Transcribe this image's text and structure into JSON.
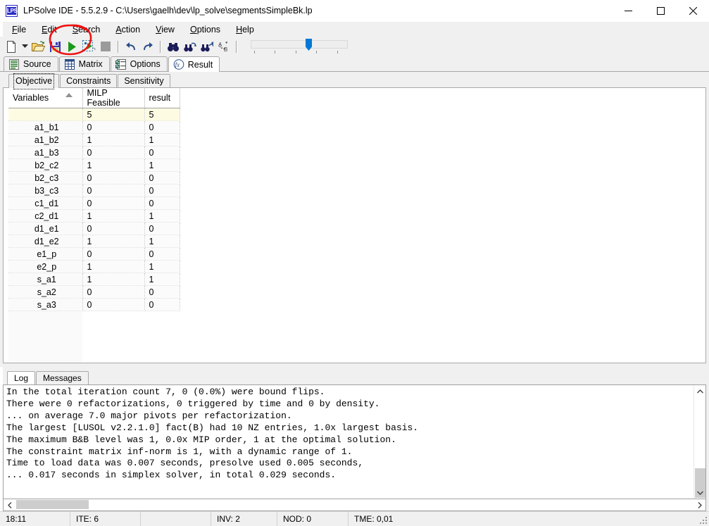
{
  "window": {
    "title": "LPSolve IDE - 5.5.2.9 - C:\\Users\\gaelh\\dev\\lp_solve\\segmentsSimpleBk.lp",
    "icon": "LPS",
    "minimize_label": "Minimize",
    "maximize_label": "Maximize",
    "close_label": "Close"
  },
  "menu": {
    "items": [
      {
        "accel": "F",
        "rest": "ile",
        "name": "file"
      },
      {
        "accel": "E",
        "rest": "dit",
        "name": "edit"
      },
      {
        "accel": "S",
        "rest": "earch",
        "name": "search"
      },
      {
        "accel": "A",
        "rest": "ction",
        "name": "action"
      },
      {
        "accel": "V",
        "rest": "iew",
        "name": "view"
      },
      {
        "accel": "O",
        "rest": "ptions",
        "name": "options"
      },
      {
        "accel": "H",
        "rest": "elp",
        "name": "help"
      }
    ]
  },
  "toolbar": {
    "buttons": [
      {
        "icon": "new-file-icon",
        "label": "New"
      },
      {
        "icon": "dropdown-arrow-icon",
        "label": "New dropdown"
      },
      {
        "icon": "open-folder-icon",
        "label": "Open"
      },
      {
        "icon": "save-disk-icon",
        "label": "Save"
      },
      {
        "icon": "run-play-icon",
        "label": "Solve"
      },
      {
        "icon": "run-selection-icon",
        "label": "Solve selection"
      },
      {
        "icon": "stop-square-icon",
        "label": "Stop"
      },
      {
        "icon": "undo-arrow-icon",
        "label": "Undo"
      },
      {
        "icon": "redo-arrow-icon",
        "label": "Redo"
      },
      {
        "icon": "binoculars-find-icon",
        "label": "Find"
      },
      {
        "icon": "find-next-icon",
        "label": "Find next"
      },
      {
        "icon": "find-previous-icon",
        "label": "Find previous"
      },
      {
        "icon": "replace-ab-icon",
        "label": "Replace"
      }
    ],
    "slider": {
      "value": 57,
      "ticks": 5
    }
  },
  "main_tabs": [
    {
      "label": "Source",
      "icon": "document-lines-icon",
      "active": false
    },
    {
      "label": "Matrix",
      "icon": "grid-table-icon",
      "active": false
    },
    {
      "label": "Options",
      "icon": "checklist-icon",
      "active": false
    },
    {
      "label": "Result",
      "icon": "fx-function-icon",
      "active": true
    }
  ],
  "result_tabs": [
    {
      "label": "Objective",
      "active": true
    },
    {
      "label": "Constraints",
      "active": false
    },
    {
      "label": "Sensitivity",
      "active": false
    }
  ],
  "grid": {
    "columns": [
      {
        "label": "Variables",
        "sorted": true,
        "sort_dir": "asc"
      },
      {
        "label": "MILP Feasible",
        "sorted": false
      },
      {
        "label": "result",
        "sorted": false
      }
    ],
    "objective_row": {
      "name": "",
      "milp_feasible": "5",
      "result": "5"
    },
    "rows": [
      {
        "name": "a1_b1",
        "milp_feasible": "0",
        "result": "0"
      },
      {
        "name": "a1_b2",
        "milp_feasible": "1",
        "result": "1"
      },
      {
        "name": "a1_b3",
        "milp_feasible": "0",
        "result": "0"
      },
      {
        "name": "b2_c2",
        "milp_feasible": "1",
        "result": "1"
      },
      {
        "name": "b2_c3",
        "milp_feasible": "0",
        "result": "0"
      },
      {
        "name": "b3_c3",
        "milp_feasible": "0",
        "result": "0"
      },
      {
        "name": "c1_d1",
        "milp_feasible": "0",
        "result": "0"
      },
      {
        "name": "c2_d1",
        "milp_feasible": "1",
        "result": "1"
      },
      {
        "name": "d1_e1",
        "milp_feasible": "0",
        "result": "0"
      },
      {
        "name": "d1_e2",
        "milp_feasible": "1",
        "result": "1"
      },
      {
        "name": "e1_p",
        "milp_feasible": "0",
        "result": "0"
      },
      {
        "name": "e2_p",
        "milp_feasible": "1",
        "result": "1"
      },
      {
        "name": "s_a1",
        "milp_feasible": "1",
        "result": "1"
      },
      {
        "name": "s_a2",
        "milp_feasible": "0",
        "result": "0"
      },
      {
        "name": "s_a3",
        "milp_feasible": "0",
        "result": "0"
      }
    ]
  },
  "log_tabs": [
    {
      "label": "Log",
      "active": true
    },
    {
      "label": "Messages",
      "active": false
    }
  ],
  "log": {
    "text": "In the total iteration count 7, 0 (0.0%) were bound flips.\nThere were 0 refactorizations, 0 triggered by time and 0 by density.\n... on average 7.0 major pivots per refactorization.\nThe largest [LUSOL v2.2.1.0] fact(B) had 10 NZ entries, 1.0x largest basis.\nThe maximum B&B level was 1, 0.0x MIP order, 1 at the optimal solution.\nThe constraint matrix inf-norm is 1, with a dynamic range of 1.\nTime to load data was 0.007 seconds, presolve used 0.005 seconds,\n... 0.017 seconds in simplex solver, in total 0.029 seconds."
  },
  "statusbar": {
    "cells": [
      {
        "text": "18:11",
        "name": "status-time"
      },
      {
        "text": "ITE: 6",
        "name": "status-iterations"
      },
      {
        "text": "",
        "name": "status-spacer"
      },
      {
        "text": "INV: 2",
        "name": "status-inversions"
      },
      {
        "text": "NOD: 0",
        "name": "status-nodes"
      },
      {
        "text": "TME: 0,01",
        "name": "status-elapsed-time"
      }
    ]
  },
  "annotation": {
    "shape": "hand-drawn-red-ellipse",
    "color": "#ee1111",
    "target": "solve-toolbar-buttons"
  },
  "colors": {
    "accent": "#0078d7",
    "objective_row_bg": "#fdfce3",
    "annotation_red": "#ee1111",
    "window_bg": "#f0f0f0"
  }
}
